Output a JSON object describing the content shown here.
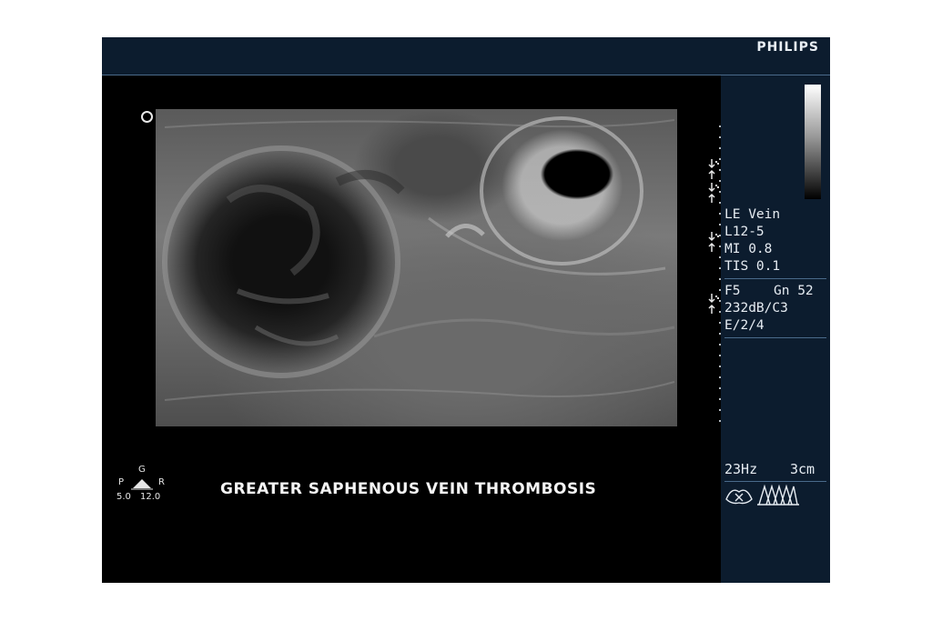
{
  "brand": "PHILIPS",
  "caption": "GREATER SAPHENOUS VEIN THROMBOSIS",
  "orientation_indicator": {
    "top": "G",
    "left": "P",
    "right": "R",
    "bottom_left": "5.0",
    "bottom_right": "12.0"
  },
  "params": {
    "preset": "LE Vein",
    "transducer": "L12-5",
    "mi": "MI 0.8",
    "tis": "TIS 0.1",
    "freq_gain_f": "F5",
    "freq_gain_gn": "Gn 52",
    "dynamic": "232dB/C3",
    "persist": "E/2/4",
    "frame_rate": "23Hz",
    "depth": "3cm"
  },
  "icons": {
    "grayscale_bar": "grayscale-map-bar",
    "focus_marker": "focus-zone-marker-icon",
    "sonocт_icon": "sonoct-x-icon",
    "beam_icon": "beam-steering-icon",
    "orientation_dot": "orientation-marker-icon"
  },
  "colors": {
    "panel_bg": "#0c1c2e",
    "separator": "#4a6a8a",
    "text": "#e6ecf2"
  }
}
